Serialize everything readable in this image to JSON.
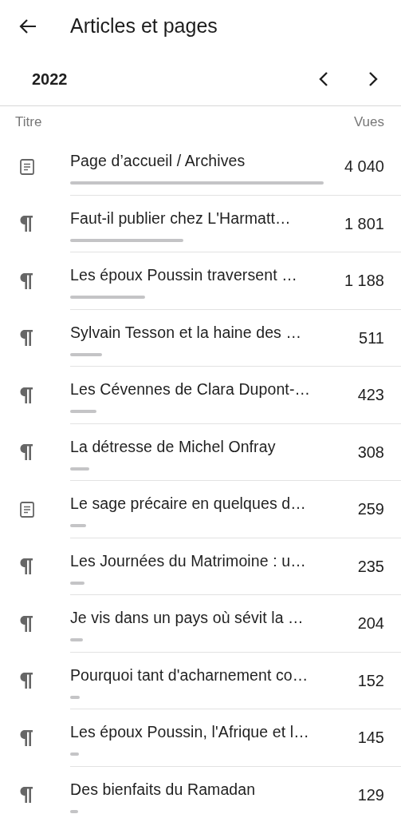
{
  "header": {
    "title": "Articles et pages"
  },
  "period": {
    "label": "2022"
  },
  "columns": [
    "Titre",
    "Vues"
  ],
  "rows": [
    {
      "kind": "page",
      "title": "Page d’accueil / Archives",
      "views": "4 040"
    },
    {
      "kind": "post",
      "title": "Faut-il publier chez L'Harmatt…",
      "views": "1 801"
    },
    {
      "kind": "post",
      "title": "Les époux Poussin traversent …",
      "views": "1 188"
    },
    {
      "kind": "post",
      "title": "Sylvain Tesson et la haine des …",
      "views": "511"
    },
    {
      "kind": "post",
      "title": "Les Cévennes de Clara Dupont-…",
      "views": "423"
    },
    {
      "kind": "post",
      "title": "La détresse de Michel Onfray",
      "views": "308"
    },
    {
      "kind": "page",
      "title": "Le sage précaire en quelques d…",
      "views": "259"
    },
    {
      "kind": "post",
      "title": "Les Journées du Matrimoine : u…",
      "views": "235"
    },
    {
      "kind": "post",
      "title": "Je vis dans un pays où sévit la …",
      "views": "204"
    },
    {
      "kind": "post",
      "title": "Pourquoi tant d'acharnement co…",
      "views": "152"
    },
    {
      "kind": "post",
      "title": "Les époux Poussin, l'Afrique et l…",
      "views": "145"
    },
    {
      "kind": "post",
      "title": "Des bienfaits du Ramadan",
      "views": "129"
    }
  ]
}
